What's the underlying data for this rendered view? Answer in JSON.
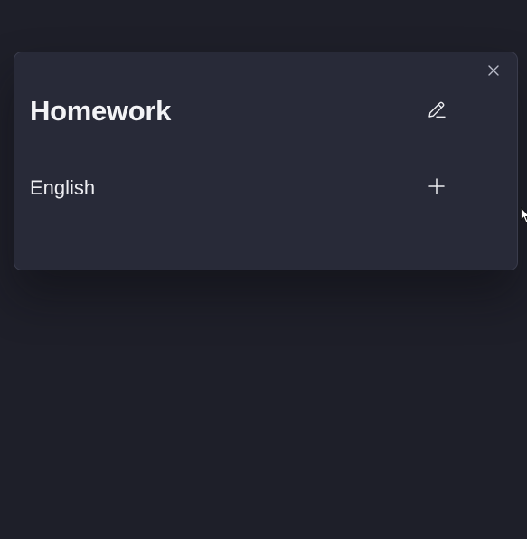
{
  "card": {
    "title": "Homework",
    "items": [
      {
        "label": "English"
      }
    ]
  },
  "icons": {
    "close": "close-icon",
    "edit": "pencil-icon",
    "add": "plus-icon",
    "cursor": "mouse-pointer-icon"
  },
  "colors": {
    "background": "#1e1f29",
    "card": "#282a38",
    "text": "#f3f3f6"
  }
}
